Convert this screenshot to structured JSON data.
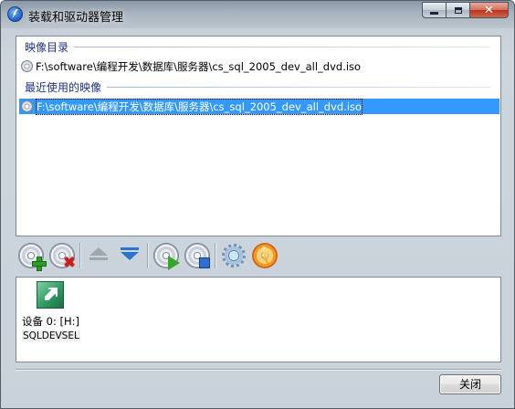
{
  "window": {
    "title": "装载和驱动器管理"
  },
  "image_list": {
    "groups": [
      {
        "header": "映像目录",
        "items": [
          {
            "path": "F:\\software\\编程开发\\数据库\\服务器\\cs_sql_2005_dev_all_dvd.iso",
            "selected": false
          }
        ]
      },
      {
        "header": "最近使用的映像",
        "items": [
          {
            "path": "F:\\software\\编程开发\\数据库\\服务器\\cs_sql_2005_dev_all_dvd.iso",
            "selected": true
          }
        ]
      }
    ]
  },
  "toolbar": {
    "buttons": [
      {
        "icon": "add-disc-icon"
      },
      {
        "icon": "remove-disc-icon"
      },
      {
        "icon": "eject-icon",
        "disabled": true
      },
      {
        "icon": "insert-icon"
      },
      {
        "icon": "mount-play-disc-icon"
      },
      {
        "icon": "unmount-stop-disc-icon"
      },
      {
        "icon": "gear-icon"
      },
      {
        "icon": "burn-disc-icon"
      }
    ]
  },
  "devices": [
    {
      "label": "设备 0: [H:]",
      "sublabel": "SQLDEVSEL",
      "icon": "virtual-drive-icon"
    }
  ],
  "footer": {
    "close_label": "关闭"
  },
  "colors": {
    "selection": "#3399ff",
    "group_header_text": "#1e3287",
    "close_caption": "#c8402a"
  }
}
